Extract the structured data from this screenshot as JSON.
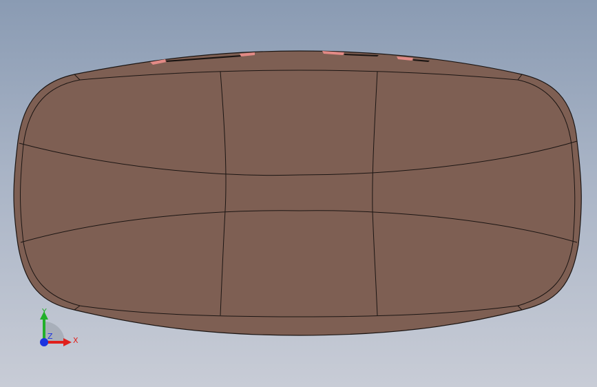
{
  "viewport": {
    "background_top": "#8a9bb3",
    "background_bottom": "#c8ccd6"
  },
  "model": {
    "face_color": "#7e5f53",
    "edge_color": "#1a1412",
    "highlight_color": "#e28a86"
  },
  "triad": {
    "x_label": "X",
    "y_label": "Y",
    "z_label": "Z",
    "x_color": "#e0201c",
    "y_color": "#22b02a",
    "z_color": "#1c33e0"
  }
}
